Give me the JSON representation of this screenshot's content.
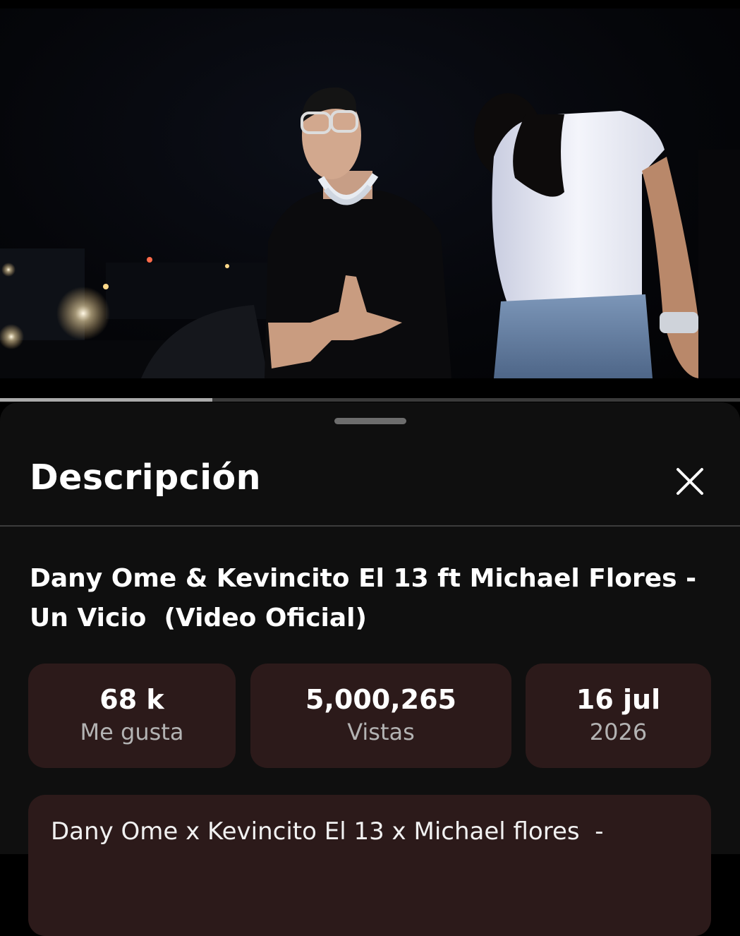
{
  "player": {
    "progress_fraction": 0.287,
    "progress_color": "#aaaaaa"
  },
  "sheet": {
    "title": "Descripción",
    "close_icon": "close-icon",
    "video_title_line1": "Dany Ome & Kevincito El 13 ft Michael Flores -",
    "video_title_line2": "Un Vicio  (Video Oficial)",
    "stats": [
      {
        "value": "68 k",
        "label": "Me gusta"
      },
      {
        "value": "5,000,265",
        "label": "Vistas"
      },
      {
        "value": "16 jul",
        "label": "2026"
      }
    ],
    "description_preview": "Dany Ome x Kevincito El 13 x Michael flores  -",
    "accent_box_color": "#2c1a1a"
  }
}
